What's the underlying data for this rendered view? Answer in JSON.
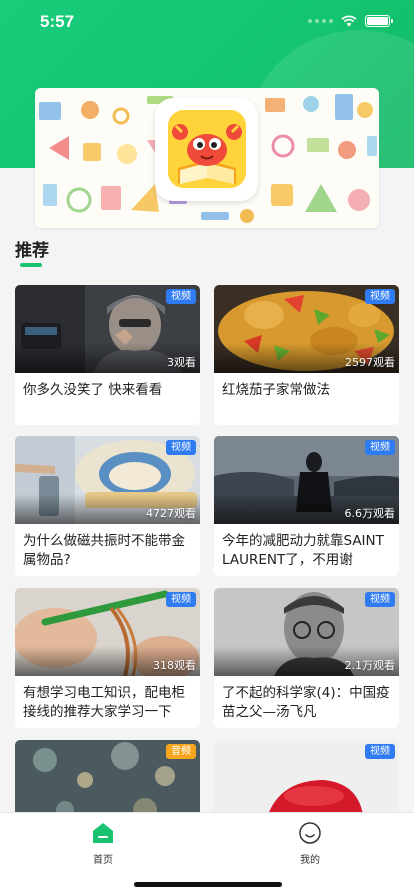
{
  "status_bar": {
    "time": "5:57"
  },
  "section": {
    "title": "推荐"
  },
  "colors": {
    "brand_green": "#18c26f",
    "video_badge": "#2f7bf2",
    "audio_badge": "#f7a51c"
  },
  "cards": [
    {
      "badge": "视频",
      "views": "3观看",
      "title": "你多久没笑了  快来看看"
    },
    {
      "badge": "视频",
      "views": "2597观看",
      "title": "红烧茄子家常做法"
    },
    {
      "badge": "视频",
      "views": "4727观看",
      "title": "为什么做磁共振时不能带金属物品?"
    },
    {
      "badge": "视频",
      "views": "6.6万观看",
      "title": "今年的减肥动力就靠SAINT LAURENT了，不用谢"
    },
    {
      "badge": "视频",
      "views": "318观看",
      "title": "有想学习电工知识，配电柜接线的推荐大家学习一下"
    },
    {
      "badge": "视频",
      "views": "2.1万观看",
      "title": "了不起的科学家(4)：中国疫苗之父—汤飞凡"
    },
    {
      "badge": "音频",
      "views": "",
      "title": ""
    },
    {
      "badge": "视频",
      "views": "",
      "title": ""
    }
  ],
  "tabbar": {
    "home": "首页",
    "mine": "我的"
  }
}
